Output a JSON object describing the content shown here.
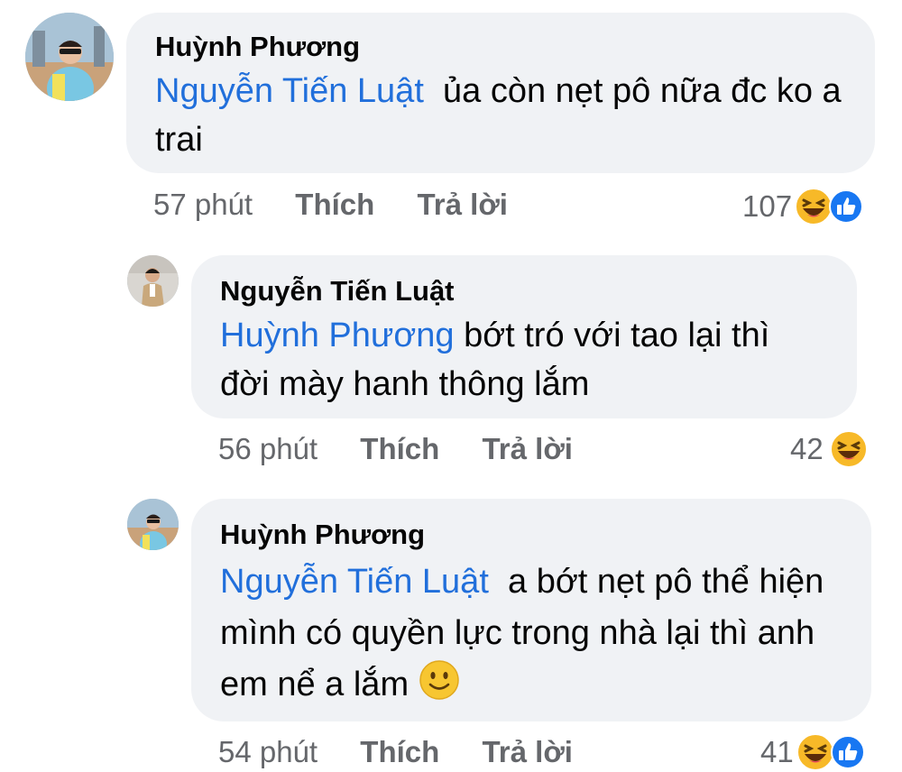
{
  "comments": [
    {
      "author": "Huỳnh Phương",
      "mention": "Nguyễn Tiến Luật",
      "text": "ủa còn nẹt pô nữa đc ko a trai",
      "time": "57 phút",
      "like_label": "Thích",
      "reply_label": "Trả lời",
      "reaction_count": "107",
      "reactions": [
        "haha-icon",
        "like-icon"
      ]
    },
    {
      "author": "Nguyễn Tiến Luật",
      "mention": "Huỳnh Phương",
      "text": "bớt tró với tao lại thì đời mày hanh thông lắm",
      "time": "56 phút",
      "like_label": "Thích",
      "reply_label": "Trả lời",
      "reaction_count": "42",
      "reactions": [
        "haha-icon"
      ]
    },
    {
      "author": "Huỳnh Phương",
      "mention": "Nguyễn Tiến Luật",
      "text": "a bớt nẹt pô thể hiện mình có quyền lực trong nhà lại thì anh em nể a lắm",
      "emoji": "slightly-smiling-icon",
      "time": "54 phút",
      "like_label": "Thích",
      "reply_label": "Trả lời",
      "reaction_count": "41",
      "reactions": [
        "haha-icon",
        "like-icon"
      ]
    }
  ],
  "colors": {
    "bubble": "#f0f2f5",
    "mention": "#216fdb",
    "meta": "#65676b",
    "like_blue": "#1877f2",
    "haha_yellow": "#f7b928"
  }
}
